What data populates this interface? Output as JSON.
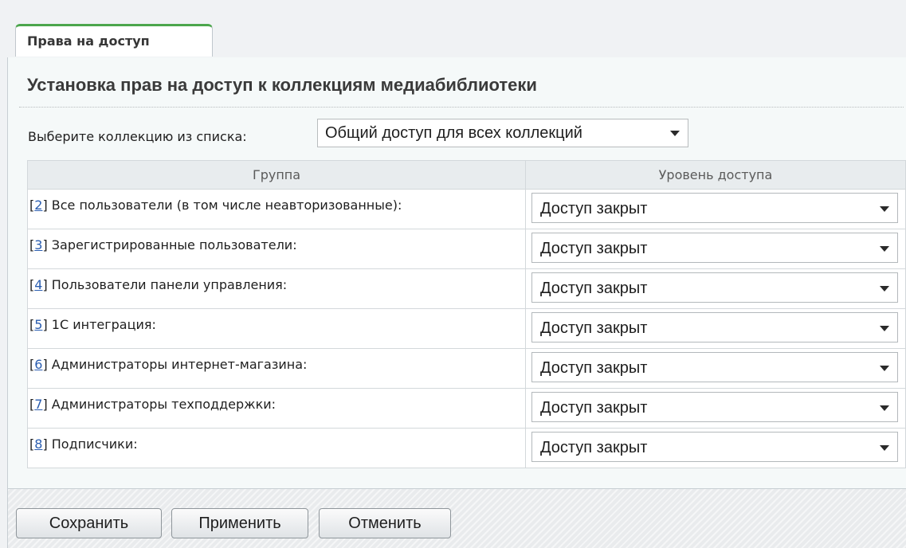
{
  "tab": {
    "label": "Права на доступ"
  },
  "panel": {
    "title": "Установка прав на доступ к коллекциям медиабиблиотеки",
    "collection_label": "Выберите коллекцию из списка:",
    "collection_value": "Общий доступ для всех коллекций"
  },
  "table": {
    "headers": [
      "Группа",
      "Уровень доступа"
    ],
    "rows": [
      {
        "id": "2",
        "name": "Все пользователи (в том числе неавторизованные):",
        "access": "Доступ закрыт"
      },
      {
        "id": "3",
        "name": "Зарегистрированные пользователи:",
        "access": "Доступ закрыт"
      },
      {
        "id": "4",
        "name": "Пользователи панели управления:",
        "access": "Доступ закрыт"
      },
      {
        "id": "5",
        "name": "1С интеграция:",
        "access": "Доступ закрыт"
      },
      {
        "id": "6",
        "name": "Администраторы интернет-магазина:",
        "access": "Доступ закрыт"
      },
      {
        "id": "7",
        "name": "Администраторы техподдержки:",
        "access": "Доступ закрыт"
      },
      {
        "id": "8",
        "name": "Подписчики:",
        "access": "Доступ закрыт"
      }
    ]
  },
  "buttons": {
    "save": "Сохранить",
    "apply": "Применить",
    "cancel": "Отменить"
  },
  "icons": {
    "dropdown": "chevron-down-icon"
  }
}
